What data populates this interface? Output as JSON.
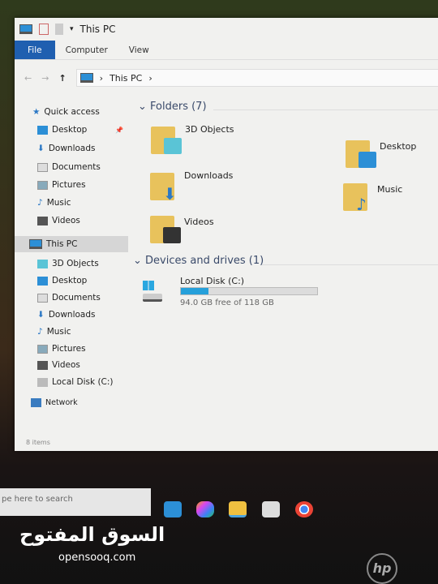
{
  "window": {
    "title": "This PC",
    "status": "8 items"
  },
  "ribbon": {
    "tabs": [
      "File",
      "Computer",
      "View"
    ]
  },
  "address": {
    "path": "This PC"
  },
  "nav": {
    "quick_access": "Quick access",
    "quick_items": [
      "Desktop",
      "Downloads",
      "Documents",
      "Pictures",
      "Music",
      "Videos"
    ],
    "this_pc": "This PC",
    "pc_items": [
      "3D Objects",
      "Desktop",
      "Documents",
      "Downloads",
      "Music",
      "Pictures",
      "Videos",
      "Local Disk (C:)"
    ],
    "network": "Network"
  },
  "content": {
    "folders_header": "Folders (7)",
    "folders": [
      "3D Objects",
      "Desktop",
      "Downloads",
      "Music",
      "Videos"
    ],
    "devices_header": "Devices and drives (1)",
    "drive": {
      "name": "Local Disk (C:)",
      "free_text": "94.0 GB free of 118 GB",
      "used_fraction": 0.2,
      "bar_color": "#26a0da"
    }
  },
  "taskbar": {
    "search_placeholder": "pe here to search"
  },
  "watermark": {
    "arabic": "السوق المفتوح",
    "latin": "opensooq.com"
  },
  "brand": "hp"
}
